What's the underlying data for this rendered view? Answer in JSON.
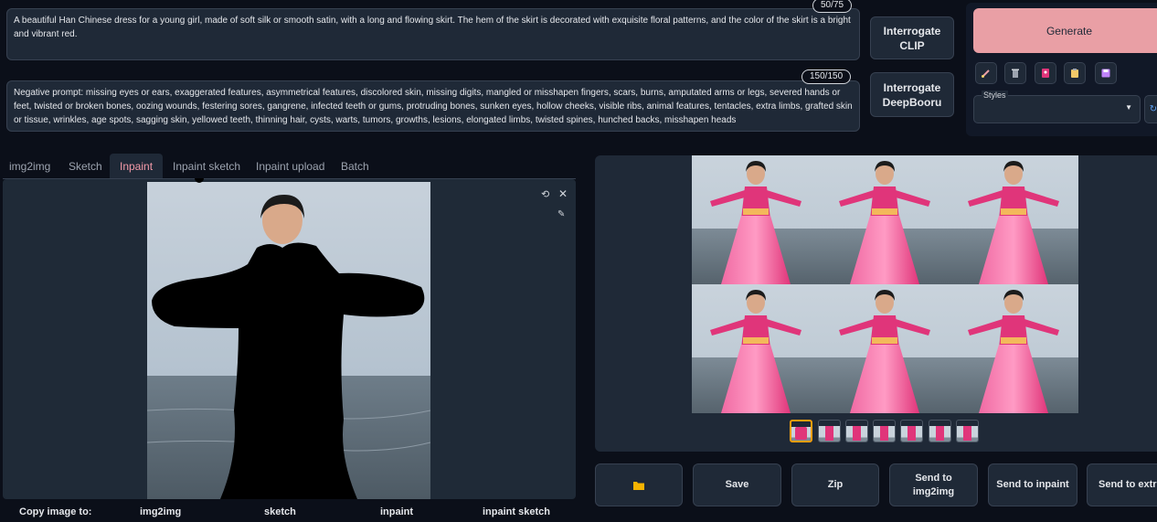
{
  "prompt": {
    "text": "A beautiful Han Chinese dress for a young girl, made of soft silk or smooth satin, with a long and flowing skirt. The hem of the skirt is decorated with exquisite floral patterns, and the color of the skirt is a bright and vibrant red.",
    "token_count": "50/75"
  },
  "negative_prompt": {
    "text": "Negative prompt: missing eyes or ears, exaggerated features, asymmetrical features, discolored skin, missing digits, mangled or misshapen fingers, scars, burns, amputated arms or legs, severed hands or feet, twisted or broken bones, oozing wounds, festering sores, gangrene, infected teeth or gums, protruding bones, sunken eyes, hollow cheeks, visible ribs, animal features, tentacles, extra limbs, grafted skin or tissue, wrinkles, age spots, sagging skin, yellowed teeth, thinning hair, cysts, warts, tumors, growths, lesions, elongated limbs, twisted spines, hunched backs, misshapen heads",
    "token_count": "150/150"
  },
  "interrogate": {
    "clip_label": "Interrogate CLIP",
    "deepbooru_label": "Interrogate DeepBooru"
  },
  "generate_label": "Generate",
  "toolbar_icons": [
    "brush-icon",
    "trash-icon",
    "style-icon",
    "clipboard-icon",
    "save-icon"
  ],
  "styles": {
    "label": "Styles",
    "value": ""
  },
  "tabs": [
    {
      "label": "img2img",
      "active": false
    },
    {
      "label": "Sketch",
      "active": false
    },
    {
      "label": "Inpaint",
      "active": true
    },
    {
      "label": "Inpaint sketch",
      "active": false
    },
    {
      "label": "Inpaint upload",
      "active": false
    },
    {
      "label": "Batch",
      "active": false
    }
  ],
  "copy_row": {
    "label": "Copy image to:",
    "targets": [
      "img2img",
      "sketch",
      "inpaint",
      "inpaint sketch"
    ]
  },
  "output_buttons": {
    "folder_icon": "folder-icon",
    "save": "Save",
    "zip": "Zip",
    "send_img2img": "Send to img2img",
    "send_inpaint": "Send to inpaint",
    "send_extras": "Send to extras"
  },
  "colors": {
    "background": "#0b0f19",
    "panel": "#1f2937",
    "accent": "#f39aa8",
    "generate": "#e99fa5",
    "dress_pink": "#e0357a"
  }
}
